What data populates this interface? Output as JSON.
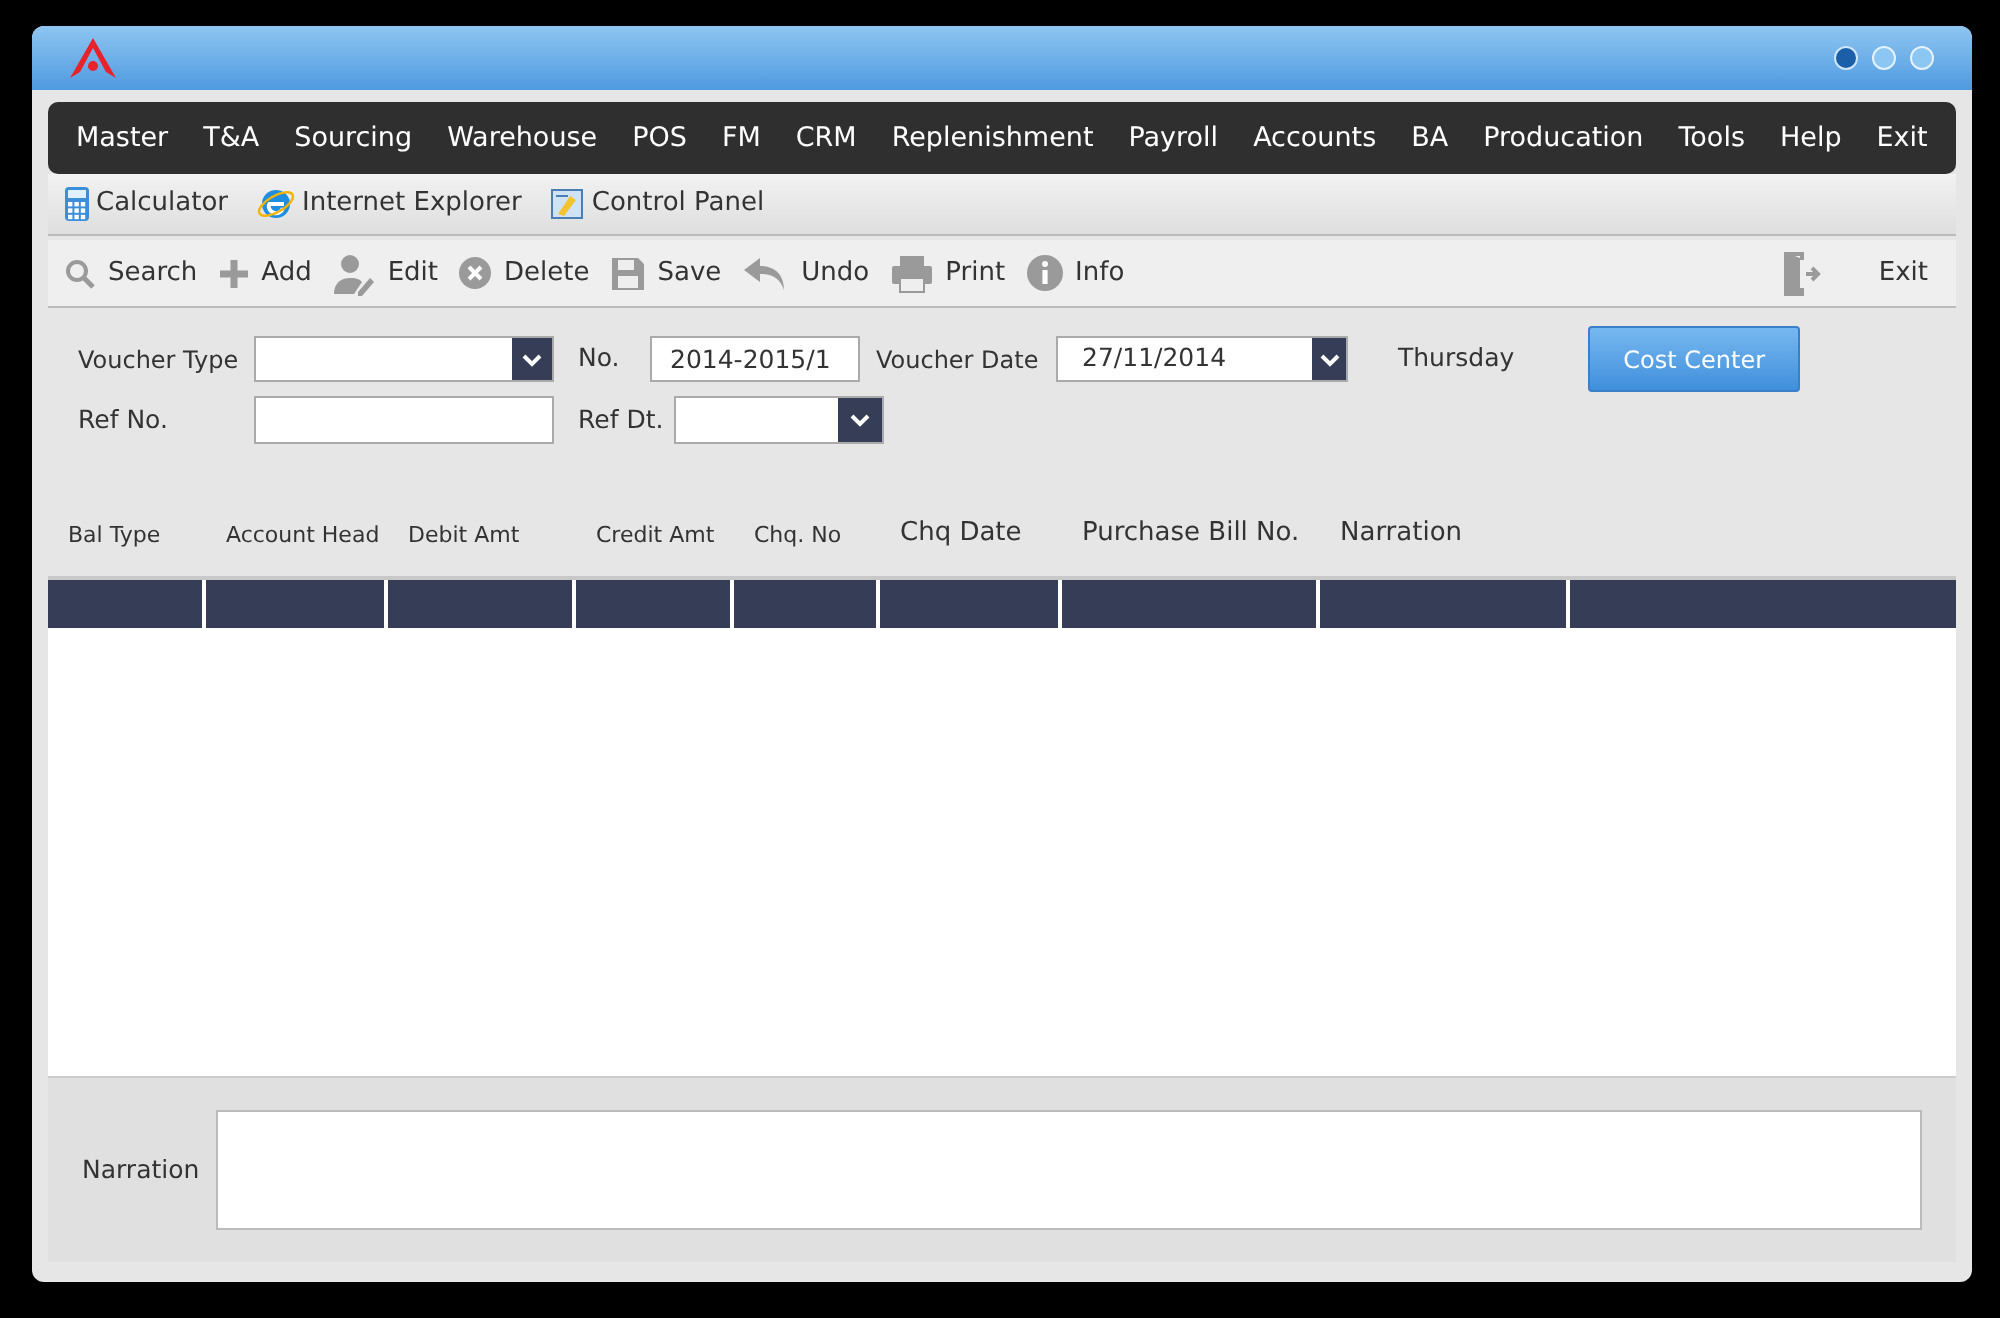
{
  "menu": [
    "Master",
    "T&A",
    "Sourcing",
    "Warehouse",
    "POS",
    "FM",
    "CRM",
    "Replenishment",
    "Payroll",
    "Accounts",
    "BA",
    "Producation",
    "Tools",
    "Help",
    "Exit"
  ],
  "quick_launch": [
    {
      "kind": "calculator",
      "label": "Calculator"
    },
    {
      "kind": "browser",
      "label": "Internet Explorer"
    },
    {
      "kind": "control-panel",
      "label": "Control Panel"
    }
  ],
  "toolbar": [
    {
      "kind": "search",
      "label": "Search"
    },
    {
      "kind": "add",
      "label": "Add"
    },
    {
      "kind": "edit",
      "label": "Edit"
    },
    {
      "kind": "delete",
      "label": "Delete"
    },
    {
      "kind": "save",
      "label": "Save"
    },
    {
      "kind": "undo",
      "label": "Undo"
    },
    {
      "kind": "print",
      "label": "Print"
    },
    {
      "kind": "info",
      "label": "Info"
    }
  ],
  "exit_button": {
    "label": "Exit"
  },
  "form": {
    "voucher_type": {
      "label": "Voucher Type"
    },
    "no": {
      "label": "No.",
      "value": "2014-2015/1"
    },
    "voucher_date": {
      "label": "Voucher Date",
      "value": "27/11/2014"
    },
    "weekday": "Thursday",
    "cost_center_button": "Cost Center",
    "ref_no": {
      "label": "Ref No."
    },
    "ref_dt": {
      "label": "Ref Dt."
    }
  },
  "table": {
    "columns": [
      "Bal Type",
      "Account Head",
      "Debit Amt",
      "Credit Amt",
      "Chq. No",
      "Chq Date",
      "Purchase Bill No.",
      "Narration"
    ]
  },
  "narration": {
    "label": "Narration"
  }
}
